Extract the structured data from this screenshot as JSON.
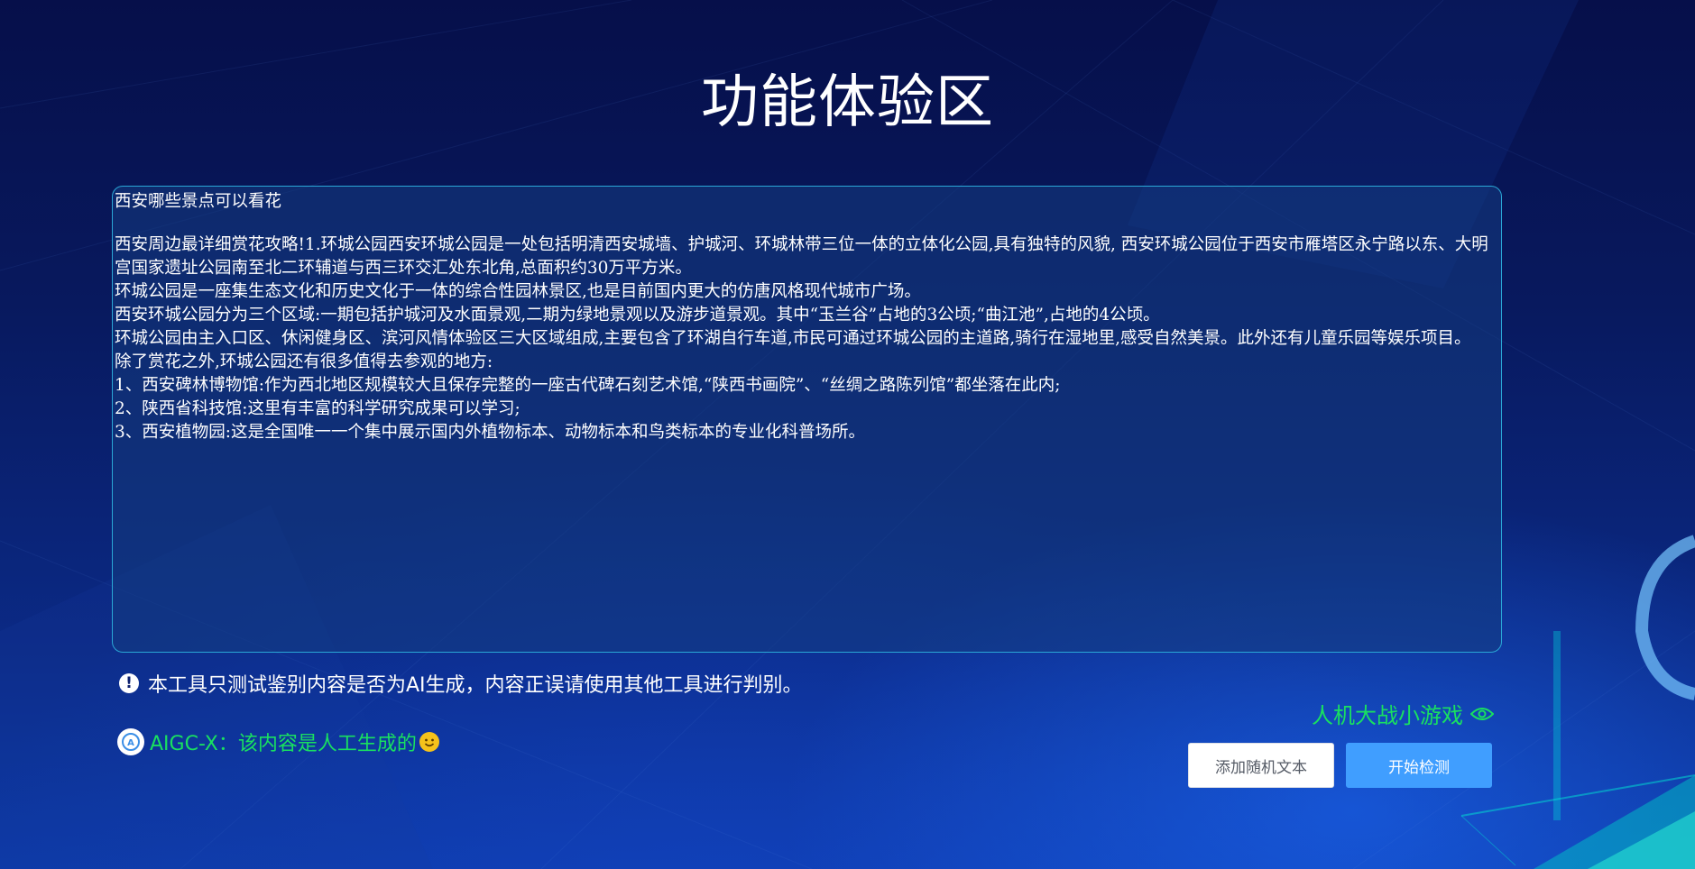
{
  "page": {
    "title": "功能体验区"
  },
  "content": {
    "question": "西安哪些景点可以看花",
    "paragraphs": [
      "西安周边最详细赏花攻略!1.环城公园西安环城公园是一处包括明清西安城墙、护城河、环城林带三位一体的立体化公园,具有独特的风貌, 西安环城公园位于西安市雁塔区永宁路以东、大明宫国家遗址公园南至北二环辅道与西三环交汇处东北角,总面积约30万平方米。",
      "环城公园是一座集生态文化和历史文化于一体的综合性园林景区,也是目前国内更大的仿唐风格现代城市广场。",
      "西安环城公园分为三个区域:一期包括护城河及水面景观,二期为绿地景观以及游步道景观。其中“玉兰谷”占地的3公顷;“曲江池”,占地的4公顷。",
      "环城公园由主入口区、休闲健身区、滨河风情体验区三大区域组成,主要包含了环湖自行车道,市民可通过环城公园的主道路,骑行在湿地里,感受自然美景。此外还有儿童乐园等娱乐项目。",
      "除了赏花之外,环城公园还有很多值得去参观的地方:",
      "1、西安碑林博物馆:作为西北地区规模较大且保存完整的一座古代碑石刻艺术馆,“陕西书画院”、“丝绸之路陈列馆”都坐落在此内;",
      "2、陕西省科技馆:这里有丰富的科学研究成果可以学习;",
      "3、西安植物园:这是全国唯一一个集中展示国内外植物标本、动物标本和鸟类标本的专业化科普场所。"
    ]
  },
  "notice": {
    "icon": "exclamation-icon",
    "text": "本工具只测试鉴别内容是否为AI生成，内容正误请使用其他工具进行判别。"
  },
  "result": {
    "logo_icon": "aigc-x-logo-icon",
    "text": "AIGC-X：该内容是人工生成的",
    "emoji_icon": "smiley-icon",
    "color": "#19e060"
  },
  "game": {
    "label": "人机大战小游戏",
    "icon": "eye-icon"
  },
  "buttons": {
    "random_label": "添加随机文本",
    "detect_label": "开始检测",
    "detect_color": "#409eff"
  }
}
